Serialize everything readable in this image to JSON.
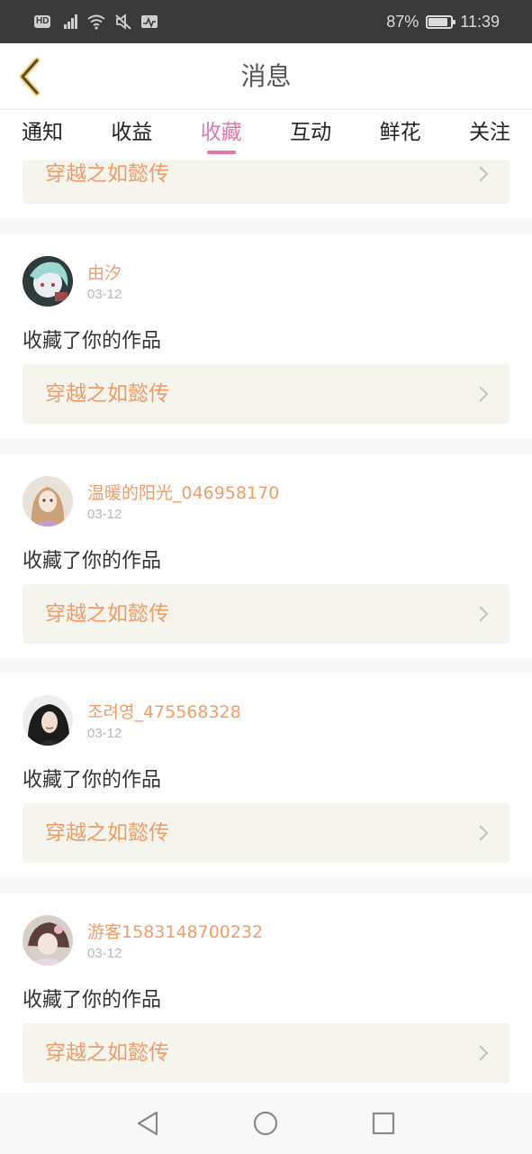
{
  "status_bar": {
    "hd_label": "HD",
    "network_label": "4G",
    "battery_text": "87%",
    "battery_level": 0.87,
    "time": "11:39",
    "icons": [
      "hd-icon",
      "signal-icon",
      "wifi-icon",
      "mute-icon",
      "activity-icon",
      "battery-icon"
    ]
  },
  "header": {
    "title": "消息",
    "back_icon": "chevron-left-icon"
  },
  "tabs": [
    {
      "label": "通知",
      "active": false
    },
    {
      "label": "收益",
      "active": false
    },
    {
      "label": "收藏",
      "active": true
    },
    {
      "label": "互动",
      "active": false
    },
    {
      "label": "鲜花",
      "active": false
    },
    {
      "label": "关注",
      "active": false
    }
  ],
  "partial_item": {
    "work_title": "穿越之如懿传"
  },
  "notifications": [
    {
      "username": "由汐",
      "date": "03-12",
      "action": "收藏了你的作品",
      "work_title": "穿越之如懿传"
    },
    {
      "username": "温暖的阳光_046958170",
      "date": "03-12",
      "action": "收藏了你的作品",
      "work_title": "穿越之如懿传"
    },
    {
      "username": "조려영_475568328",
      "date": "03-12",
      "action": "收藏了你的作品",
      "work_title": "穿越之如懿传"
    },
    {
      "username": "游客1583148700232",
      "date": "03-12",
      "action": "收藏了你的作品",
      "work_title": "穿越之如懿传"
    }
  ],
  "nav_bar": {
    "icons": [
      "back-triangle-icon",
      "home-circle-icon",
      "recents-square-icon"
    ]
  },
  "colors": {
    "accent_pink": "#e476ab",
    "orange_text": "#ee9d6a",
    "work_row_bg": "#f5f5ee",
    "status_bar_bg": "#3a3a3a"
  }
}
